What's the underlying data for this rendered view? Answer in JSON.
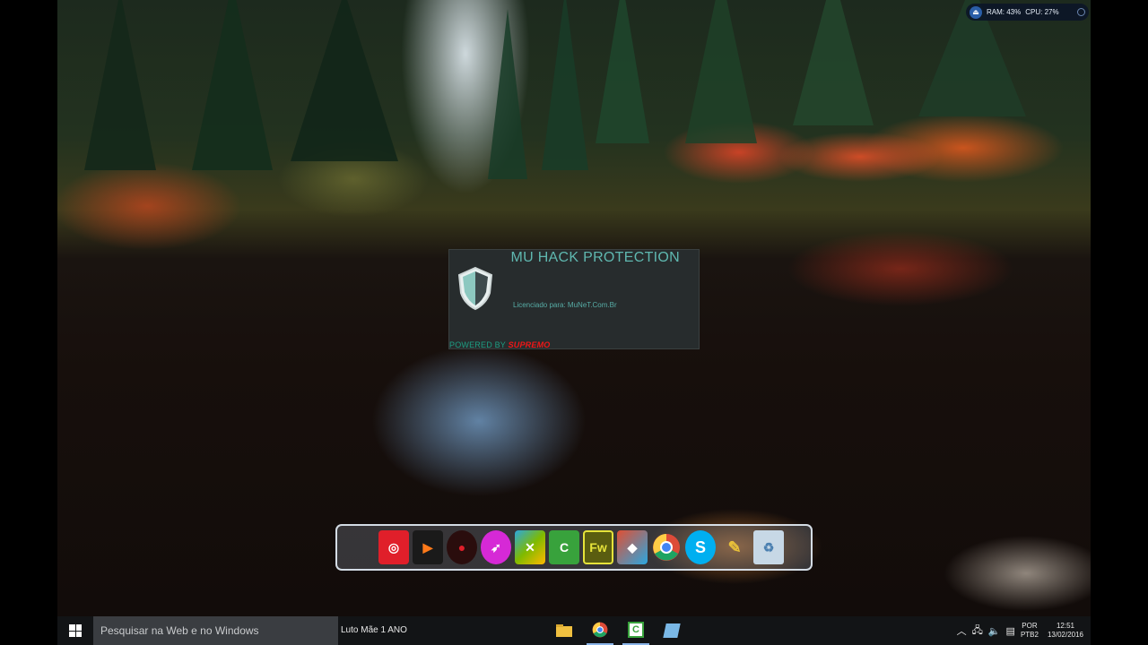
{
  "system_monitor": {
    "icon": "monitor-app-icon",
    "ram_text": "RAM: 43%",
    "cpu_text": "CPU: 27%"
  },
  "splash": {
    "title": "MU HACK PROTECTION",
    "licensed_text": "Licenciado para: MuNeT.Com.Br",
    "powered_prefix": "POWERED BY",
    "powered_brand": "SUPREMO",
    "icon": "shield-icon",
    "accent_color": "#5fb8b0"
  },
  "dock": {
    "items": [
      {
        "name": "office-icon",
        "color": "#e8432a"
      },
      {
        "name": "target-app-icon",
        "color": "#e01f2a"
      },
      {
        "name": "clownfish-icon",
        "color": "#1a1a1a"
      },
      {
        "name": "dark-app-icon",
        "color": "#2a0d0d"
      },
      {
        "name": "magenta-app-icon",
        "color": "#d629d6"
      },
      {
        "name": "colorful-x-icon",
        "color": "#2ba7e0"
      },
      {
        "name": "c-app-icon",
        "color": "#38a23c"
      },
      {
        "name": "fireworks-icon",
        "color": "#5a5d10",
        "text": "Fw"
      },
      {
        "name": "eraser-app-icon",
        "color": "#e04f33"
      },
      {
        "name": "chrome-icon",
        "color": "#dd4b39"
      },
      {
        "name": "skype-icon",
        "color": "#00aff0",
        "text": "S"
      },
      {
        "name": "notes-app-icon",
        "color": "#e8c039"
      },
      {
        "name": "recycle-bin-icon",
        "color": "#c7d8e6"
      }
    ]
  },
  "taskbar": {
    "search_placeholder": "Pesquisar na Web e no Windows",
    "label": "Luto Mãe 1 ANO",
    "apps": [
      {
        "name": "file-explorer-icon",
        "color": "#f0c040"
      },
      {
        "name": "chrome-taskbar-icon",
        "color": "#dd4b39"
      },
      {
        "name": "c-taskbar-icon",
        "color": "#38a23c"
      },
      {
        "name": "app-taskbar-icon",
        "color": "#7ab8e6"
      }
    ],
    "tray": {
      "lang_line1": "POR",
      "lang_line2": "PTB2",
      "time": "12:51",
      "date": "13/02/2016"
    }
  }
}
